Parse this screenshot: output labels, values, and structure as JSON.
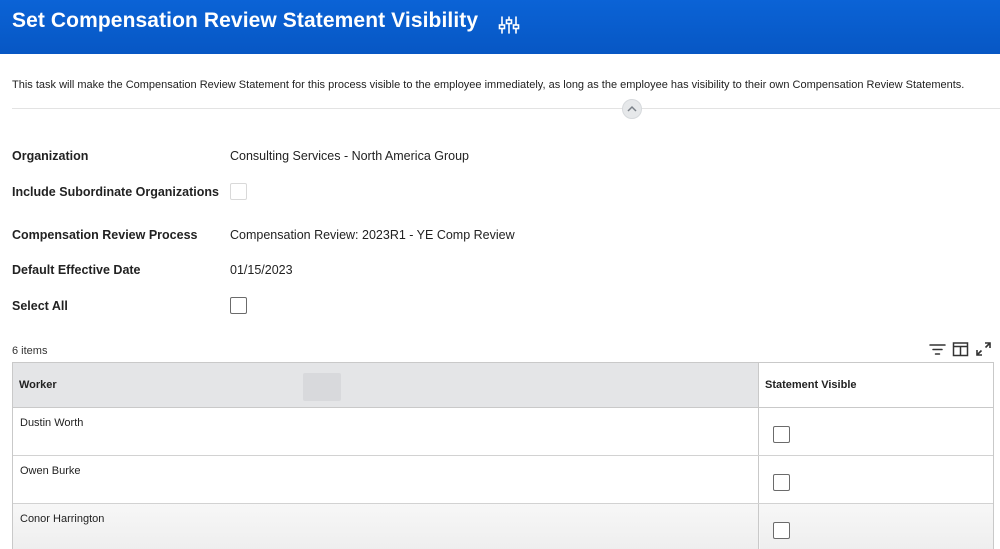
{
  "header": {
    "title": "Set Compensation Review Statement Visibility",
    "related_actions_icon": "related-actions-icon",
    "background_color": "#0757c4"
  },
  "description": "This task will make the Compensation Review Statement for this process visible to the employee immediately, as long as the employee has visibility to their own Compensation Review Statements.",
  "collapse_icon": "chevron-up-icon",
  "form": {
    "organization": {
      "label": "Organization",
      "value": "Consulting Services - North America Group"
    },
    "include_subordinates": {
      "label": "Include Subordinate Organizations",
      "checked": false
    },
    "review_process": {
      "label": "Compensation Review Process",
      "value": "Compensation Review: 2023R1 - YE Comp Review"
    },
    "effective_date": {
      "label": "Default Effective Date",
      "value": "01/15/2023"
    },
    "select_all": {
      "label": "Select All",
      "checked": false
    }
  },
  "grid": {
    "items_count": "6 items",
    "toolbar_icons": [
      "filter-icon",
      "column-layout-icon",
      "expand-icon"
    ],
    "columns": [
      "Worker",
      "Statement Visible"
    ],
    "rows": [
      {
        "worker": "Dustin Worth",
        "statement_visible": false
      },
      {
        "worker": "Owen Burke",
        "statement_visible": false
      },
      {
        "worker": "Conor Harrington",
        "statement_visible": false
      }
    ]
  }
}
